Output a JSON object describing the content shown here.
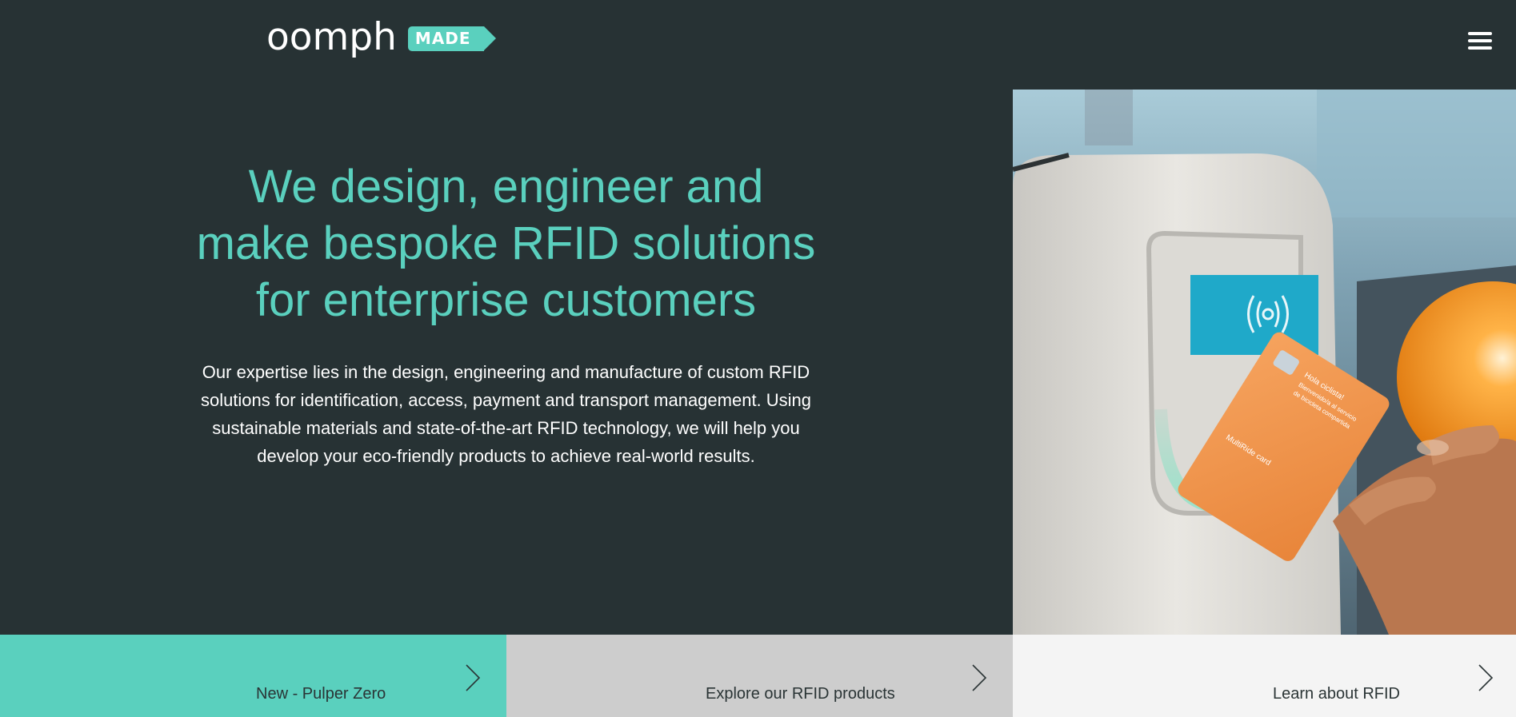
{
  "header": {
    "logo_word": "oomph",
    "logo_tag": "MADE",
    "menu_icon": "hamburger-menu-icon"
  },
  "hero": {
    "title_lines": [
      "We design, engineer and",
      "make bespoke RFID solutions",
      "for enterprise customers"
    ],
    "body_lines": [
      "Our expertise lies in the design, engineering and manufacture of custom RFID",
      "solutions for identification, access, payment and transport management. Using",
      "sustainable materials and state-of-the-art RFID technology, we will help you",
      "develop your eco-friendly products to achieve real-world results."
    ]
  },
  "photo": {
    "card_lines": [
      "Hola ciclista!",
      "Bienvenido/a al servicio",
      "de bicicleta compartida",
      "MultiRide card"
    ]
  },
  "tiles": [
    {
      "label": "New - Pulper Zero",
      "icon": "chevron-right-icon",
      "color": "#5ad0be"
    },
    {
      "label": "Explore our RFID products",
      "icon": "chevron-right-icon",
      "color": "#cdcdcd"
    },
    {
      "label": "Learn about RFID",
      "icon": "chevron-right-icon",
      "color": "#f4f4f4"
    }
  ],
  "colors": {
    "background": "#273234",
    "accent": "#5ad0be",
    "text_light": "#ffffff",
    "text_dark": "#2a3435"
  }
}
